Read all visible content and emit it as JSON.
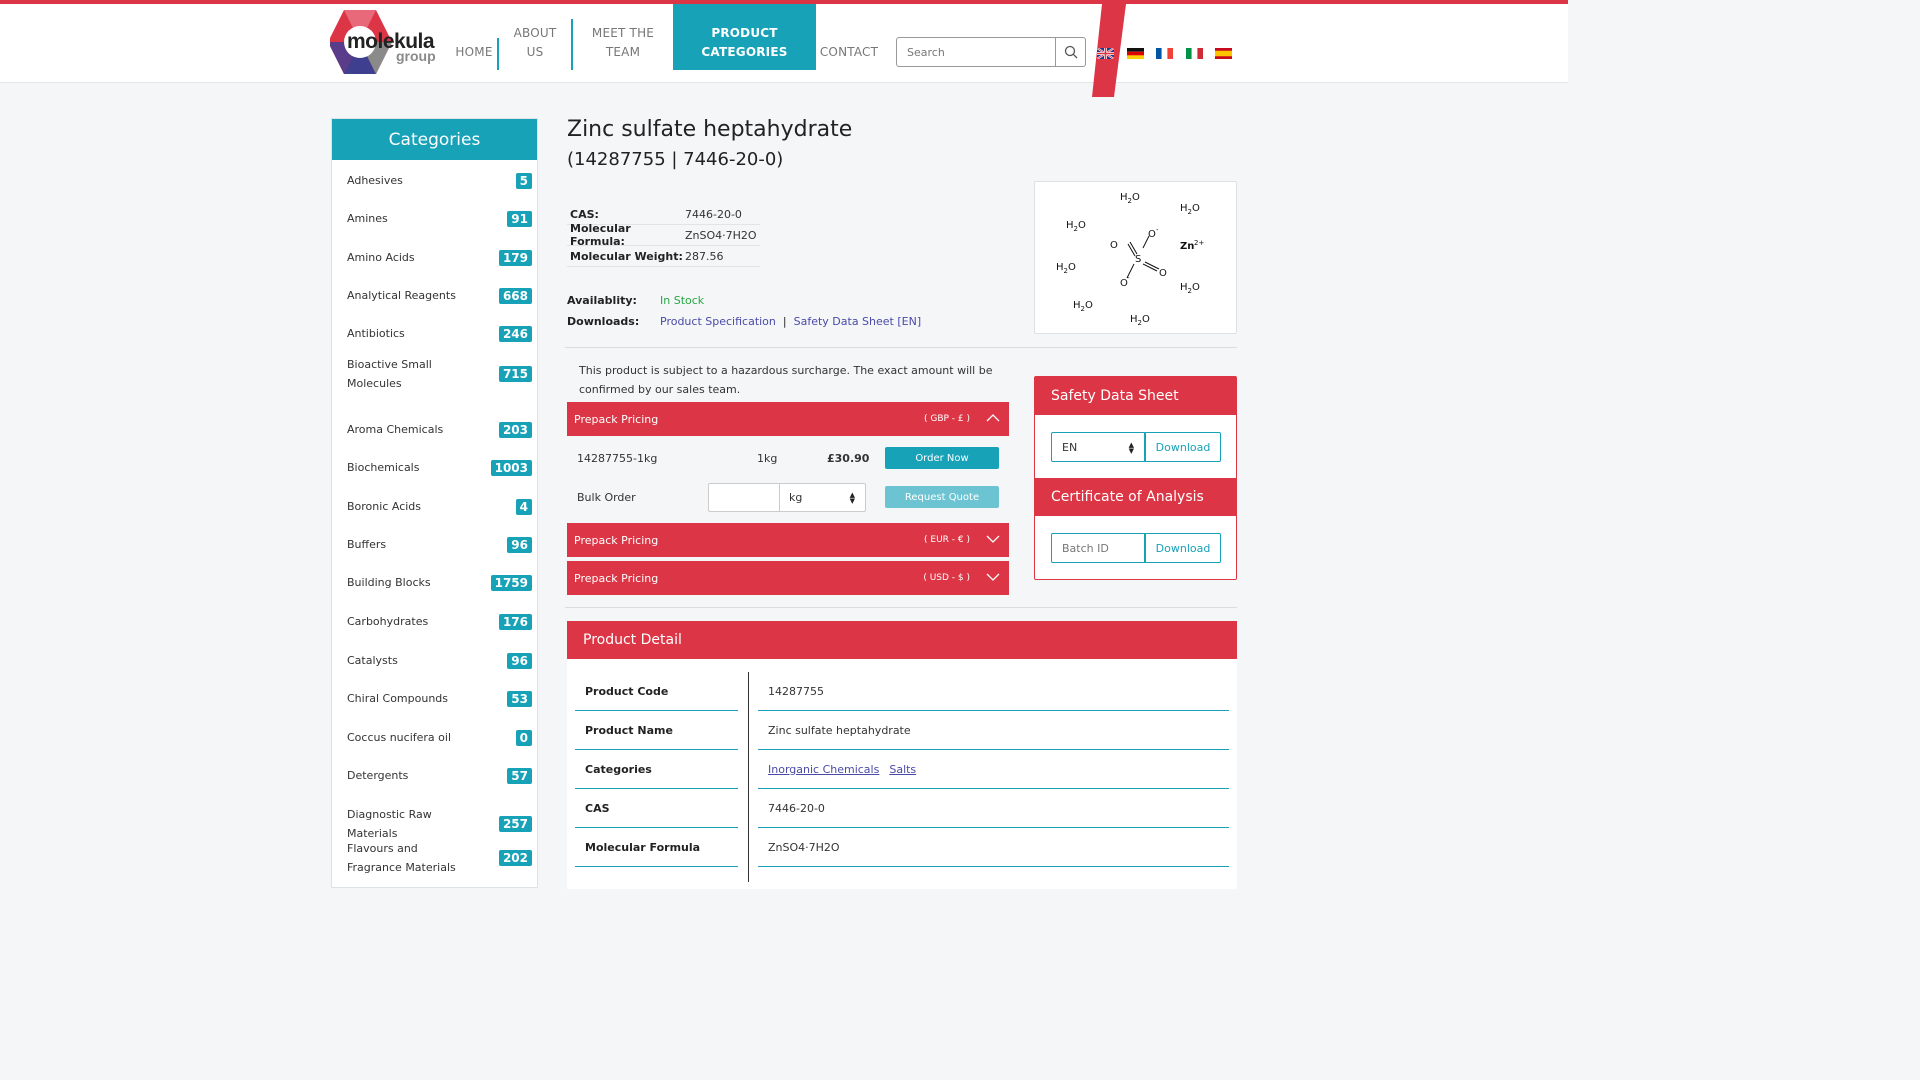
{
  "header": {
    "logo_word": "molekula",
    "logo_sub": "group",
    "nav": [
      {
        "label": "HOME"
      },
      {
        "label": "ABOUT US"
      },
      {
        "label": "MEET THE TEAM"
      },
      {
        "label": "PRODUCT CATEGORIES"
      },
      {
        "label": "CONTACT"
      }
    ],
    "search_placeholder": "Search",
    "flags": [
      "uk-flag-icon",
      "german-flag-icon",
      "french-flag-icon",
      "italian-flag-icon",
      "spanish-flag-icon"
    ]
  },
  "sidebar": {
    "title": "Categories",
    "items": [
      {
        "label": "Adhesives",
        "count": "5"
      },
      {
        "label": "Amines",
        "count": "91"
      },
      {
        "label": "Amino Acids",
        "count": "179"
      },
      {
        "label": "Analytical Reagents",
        "count": "668"
      },
      {
        "label": "Antibiotics",
        "count": "246"
      },
      {
        "label": "Bioactive Small Molecules",
        "count": "715"
      },
      {
        "label": "Aroma Chemicals",
        "count": "203"
      },
      {
        "label": "Biochemicals",
        "count": "1003"
      },
      {
        "label": "Boronic Acids",
        "count": "4"
      },
      {
        "label": "Buffers",
        "count": "96"
      },
      {
        "label": "Building Blocks",
        "count": "1759"
      },
      {
        "label": "Carbohydrates",
        "count": "176"
      },
      {
        "label": "Catalysts",
        "count": "96"
      },
      {
        "label": "Chiral Compounds",
        "count": "53"
      },
      {
        "label": "Coccus nucifera oil",
        "count": "0"
      },
      {
        "label": "Detergents",
        "count": "57"
      },
      {
        "label": "Diagnostic Raw Materials",
        "count": "257"
      },
      {
        "label": "Flavours and Fragrance Materials",
        "count": "202"
      }
    ]
  },
  "product": {
    "title": "Zinc sulfate heptahydrate",
    "subtitle": "(14287755 | 7446-20-0)",
    "props": [
      {
        "key": "CAS:",
        "value": "7446-20-0"
      },
      {
        "key": "Molecular Formula:",
        "value": "ZnSO4·7H2O"
      },
      {
        "key": "Molecular Weight:",
        "value": "287.56"
      }
    ],
    "availability_label": "Availablity:",
    "availability_value": "In Stock",
    "downloads_label": "Downloads:",
    "downloads": [
      "Product Specification",
      "Safety Data Sheet [EN]"
    ],
    "structure": {
      "h2o": [
        "H",
        "2",
        "O"
      ],
      "zn": "Zn",
      "zn_charge": "2+",
      "s": "S",
      "o": "O",
      "minus": "-"
    },
    "surcharge_note": "This product is subject to a hazardous surcharge. The exact amount will be confirmed by our sales team."
  },
  "pricing": {
    "gbp": {
      "label": "Prepack Pricing",
      "currency": "( GBP - £ )"
    },
    "eur": {
      "label": "Prepack Pricing",
      "currency": "( EUR - € )"
    },
    "usd": {
      "label": "Prepack Pricing",
      "currency": "( USD - $ )"
    },
    "row": {
      "code": "14287755-1kg",
      "size": "1kg",
      "price": "£30.90",
      "order": "Order Now"
    },
    "bulk": {
      "label": "Bulk Order",
      "unit": "kg",
      "quote": "Request Quote"
    }
  },
  "sds": {
    "title": "Safety Data Sheet",
    "lang": "EN",
    "download": "Download",
    "coa_title": "Certificate of Analysis",
    "batch_placeholder": "Batch ID",
    "coa_download": "Download"
  },
  "detail": {
    "title": "Product Detail",
    "rows": [
      {
        "key": "Product Code",
        "value": "14287755"
      },
      {
        "key": "Product Name",
        "value": "Zinc sulfate heptahydrate"
      },
      {
        "key": "Categories",
        "links": [
          "Inorganic Chemicals",
          "Salts"
        ]
      },
      {
        "key": "CAS",
        "value": "7446-20-0"
      },
      {
        "key": "Molecular Formula",
        "value": "ZnSO4·7H2O"
      }
    ]
  },
  "colors": {
    "teal": "#17a2b8",
    "red": "#dc3545",
    "green": "#28a745",
    "link": "#4a4aa8"
  }
}
